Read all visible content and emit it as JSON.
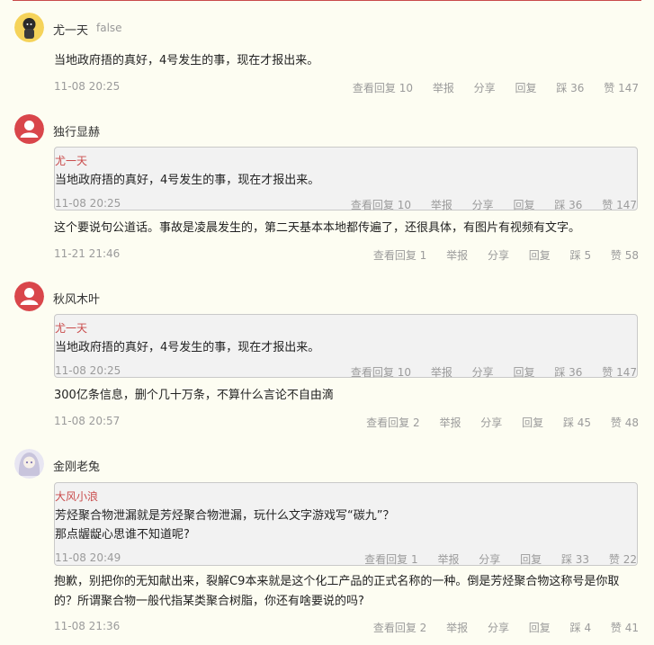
{
  "comments": [
    {
      "user": "尤一天",
      "badge": "false",
      "text": "当地政府捂的真好，4号发生的事，现在才报出来。",
      "time": "11-08 20:25",
      "replies": "查看回复 10",
      "report": "举报",
      "share": "分享",
      "reply": "回复",
      "dislike": "踩 36",
      "like": "赞 147"
    },
    {
      "user": "独行显赫",
      "quote": {
        "user": "尤一天",
        "lines": [
          "当地政府捂的真好，4号发生的事，现在才报出来。"
        ],
        "time": "11-08 20:25",
        "replies": "查看回复 10",
        "report": "举报",
        "share": "分享",
        "reply": "回复",
        "dislike": "踩 36",
        "like": "赞 147"
      },
      "text": "这个要说句公道话。事故是凌晨发生的，第二天基本本地都传遍了，还很具体，有图片有视频有文字。",
      "time": "11-21 21:46",
      "replies": "查看回复 1",
      "report": "举报",
      "share": "分享",
      "reply": "回复",
      "dislike": "踩 5",
      "like": "赞 58"
    },
    {
      "user": "秋风木叶",
      "quote": {
        "user": "尤一天",
        "lines": [
          "当地政府捂的真好，4号发生的事，现在才报出来。"
        ],
        "time": "11-08 20:25",
        "replies": "查看回复 10",
        "report": "举报",
        "share": "分享",
        "reply": "回复",
        "dislike": "踩 36",
        "like": "赞 147"
      },
      "text": "300亿条信息，删个几十万条，不算什么言论不自由滴",
      "time": "11-08 20:57",
      "replies": "查看回复 2",
      "report": "举报",
      "share": "分享",
      "reply": "回复",
      "dislike": "踩 45",
      "like": "赞 48"
    },
    {
      "user": "金刚老兔",
      "quote": {
        "user": "大风小浪",
        "lines": [
          "芳烃聚合物泄漏就是芳烃聚合物泄漏，玩什么文字游戏写“碳九”？",
          "那点龌龊心思谁不知道呢?"
        ],
        "time": "11-08 20:49",
        "replies": "查看回复 1",
        "report": "举报",
        "share": "分享",
        "reply": "回复",
        "dislike": "踩 33",
        "like": "赞 22"
      },
      "text": "抱歉，别把你的无知献出来，裂解C9本来就是这个化工产品的正式名称的一种。倒是芳烃聚合物这称号是你取的？所谓聚合物一般代指某类聚合树脂，你还有啥要说的吗?",
      "time": "11-08 21:36",
      "replies": "查看回复 2",
      "report": "举报",
      "share": "分享",
      "reply": "回复",
      "dislike": "踩 4",
      "like": "赞 41"
    }
  ],
  "colors": {
    "background": "#fdfdf2",
    "accent": "#c94b4b",
    "muted": "#9b9b9b",
    "quote_bg": "#f2f2f2"
  }
}
